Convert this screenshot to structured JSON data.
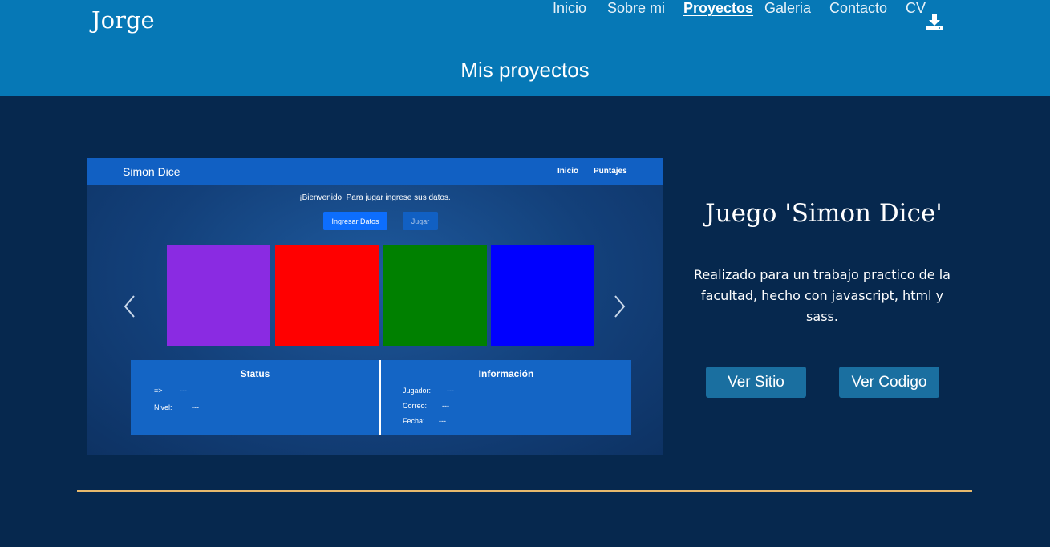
{
  "header": {
    "brand": "Jorge",
    "nav": [
      "Inicio",
      "Sobre mi",
      "Proyectos",
      "Galeria",
      "Contacto",
      "CV"
    ],
    "active_nav": "Proyectos",
    "cv_icon": "download-icon",
    "page_title": "Mis proyectos"
  },
  "project": {
    "title": "Juego 'Simon Dice'",
    "description": "Realizado para un trabajo practico de la facultad, hecho con javascript, html y sass.",
    "buttons": [
      "Ver Sitio",
      "Ver Codigo"
    ]
  },
  "screenshot": {
    "brand": "Simon Dice",
    "nav": [
      "Inicio",
      "Puntajes"
    ],
    "welcome": "¡Bienvenido! Para jugar ingrese sus datos.",
    "btn_ingresar": "Ingresar Datos",
    "btn_jugar": "Jugar",
    "squares": [
      "#8a2be2",
      "#ff0000",
      "#008000",
      "#0000ff"
    ],
    "status": {
      "title": "Status",
      "rows": [
        {
          "label": "=>",
          "value": "---"
        },
        {
          "label": "Nivel:",
          "value": "---"
        }
      ]
    },
    "info": {
      "title": "Información",
      "rows": [
        {
          "label": "Jugador:",
          "value": "---"
        },
        {
          "label": "Correo:",
          "value": "---"
        },
        {
          "label": "Fecha:",
          "value": "---"
        }
      ]
    }
  },
  "colors": {
    "header_bg": "#0678b6",
    "page_bg": "#06284e",
    "button_bg": "#1a6fa0",
    "rule": "#e6b96d"
  }
}
